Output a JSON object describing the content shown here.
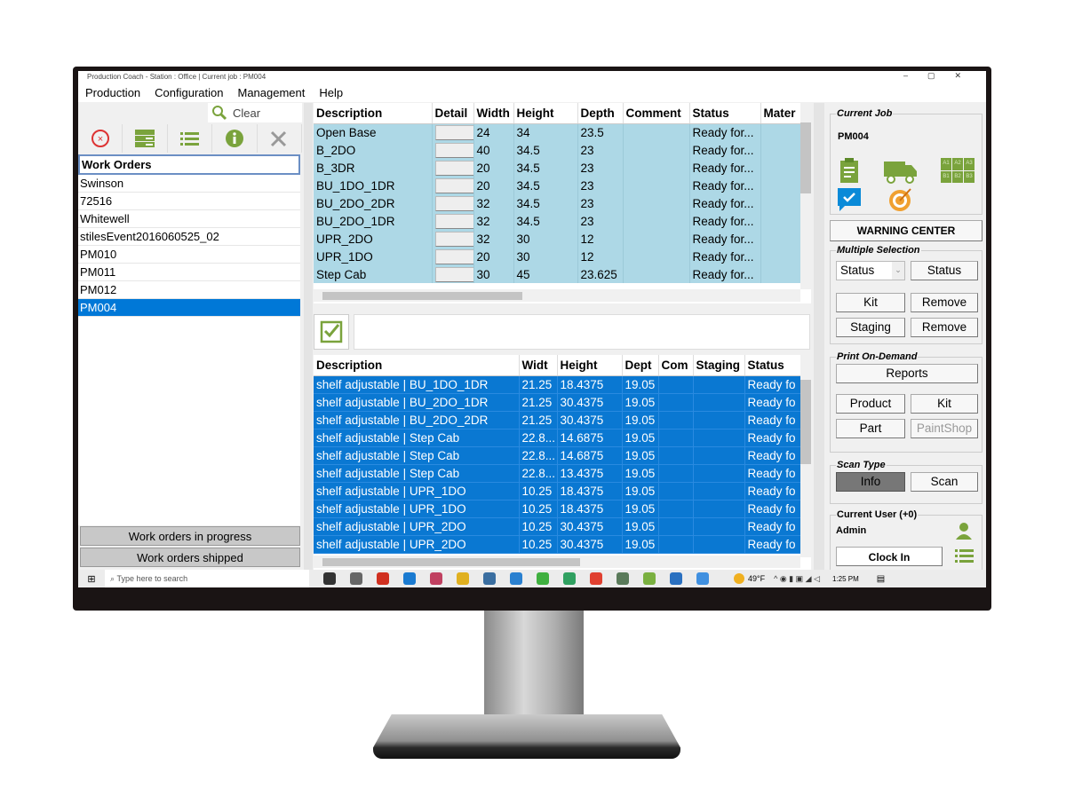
{
  "window": {
    "title": "Production Coach - Station : Office | Current job : PM004"
  },
  "menu": [
    "Production",
    "Configuration",
    "Management",
    "Help"
  ],
  "left": {
    "clear_label": "Clear",
    "list_header": "Work Orders",
    "items": [
      "Swinson",
      "72516",
      "Whitewell",
      "stilesEvent2016060525_02",
      "PM010",
      "PM011",
      "PM012",
      "PM004"
    ],
    "selected": "PM004",
    "btn_in_progress": "Work orders in progress",
    "btn_shipped": "Work orders shipped"
  },
  "top_table": {
    "columns": [
      "Description",
      "Detail",
      "Width",
      "Height",
      "Depth",
      "Comment",
      "Status",
      "Mater"
    ],
    "rows": [
      [
        "Open Base",
        "",
        "24",
        "34",
        "23.5",
        "",
        "Ready for...",
        ""
      ],
      [
        "B_2DO",
        "",
        "40",
        "34.5",
        "23",
        "",
        "Ready for...",
        ""
      ],
      [
        "B_3DR",
        "",
        "20",
        "34.5",
        "23",
        "",
        "Ready for...",
        ""
      ],
      [
        "BU_1DO_1DR",
        "",
        "20",
        "34.5",
        "23",
        "",
        "Ready for...",
        ""
      ],
      [
        "BU_2DO_2DR",
        "",
        "32",
        "34.5",
        "23",
        "",
        "Ready for...",
        ""
      ],
      [
        "BU_2DO_1DR",
        "",
        "32",
        "34.5",
        "23",
        "",
        "Ready for...",
        ""
      ],
      [
        "UPR_2DO",
        "",
        "32",
        "30",
        "12",
        "",
        "Ready for...",
        ""
      ],
      [
        "UPR_1DO",
        "",
        "20",
        "30",
        "12",
        "",
        "Ready for...",
        ""
      ],
      [
        "Step Cab",
        "",
        "30",
        "45",
        "23.625",
        "",
        "Ready for...",
        ""
      ]
    ]
  },
  "bottom_table": {
    "columns": [
      "Description",
      "Widt",
      "Height",
      "Dept",
      "Com",
      "Staging",
      "Status"
    ],
    "rows": [
      [
        "shelf adjustable | BU_1DO_1DR",
        "21.25",
        "18.4375",
        "19.05",
        "",
        "",
        "Ready fo"
      ],
      [
        "shelf adjustable | BU_2DO_1DR",
        "21.25",
        "30.4375",
        "19.05",
        "",
        "",
        "Ready fo"
      ],
      [
        "shelf adjustable | BU_2DO_2DR",
        "21.25",
        "30.4375",
        "19.05",
        "",
        "",
        "Ready fo"
      ],
      [
        "shelf adjustable | Step Cab",
        "22.8...",
        "14.6875",
        "19.05",
        "",
        "",
        "Ready fo"
      ],
      [
        "shelf adjustable | Step Cab",
        "22.8...",
        "14.6875",
        "19.05",
        "",
        "",
        "Ready fo"
      ],
      [
        "shelf adjustable | Step Cab",
        "22.8...",
        "13.4375",
        "19.05",
        "",
        "",
        "Ready fo"
      ],
      [
        "shelf adjustable | UPR_1DO",
        "10.25",
        "18.4375",
        "19.05",
        "",
        "",
        "Ready fo"
      ],
      [
        "shelf adjustable | UPR_1DO",
        "10.25",
        "18.4375",
        "19.05",
        "",
        "",
        "Ready fo"
      ],
      [
        "shelf adjustable | UPR_2DO",
        "10.25",
        "30.4375",
        "19.05",
        "",
        "",
        "Ready fo"
      ],
      [
        "shelf adjustable | UPR_2DO",
        "10.25",
        "30.4375",
        "19.05",
        "",
        "",
        "Ready fo"
      ]
    ]
  },
  "right": {
    "current_job": {
      "legend": "Current Job",
      "value": "PM004",
      "grid_labels": [
        "A1",
        "A2",
        "A3",
        "B1",
        "B2",
        "B3"
      ]
    },
    "warning_center": "WARNING CENTER",
    "multiple_selection": {
      "legend": "Multiple Selection",
      "select_value": "Status",
      "status_btn": "Status",
      "kit": "Kit",
      "remove1": "Remove",
      "staging": "Staging",
      "remove2": "Remove"
    },
    "print": {
      "legend": "Print On-Demand",
      "reports": "Reports",
      "product": "Product",
      "kit": "Kit",
      "part": "Part",
      "paintshop": "PaintShop"
    },
    "scan": {
      "legend": "Scan Type",
      "info": "Info",
      "scan": "Scan",
      "active": "Info"
    },
    "user": {
      "legend": "Current User (+0)",
      "name": "Admin",
      "clock_in": "Clock In"
    }
  },
  "taskbar": {
    "search_placeholder": "Type here to search",
    "weather": "49°F",
    "time": "1:25 PM"
  },
  "colors": {
    "accent": "#0078d7",
    "row_light": "#add8e6",
    "icon_green": "#7aa33c",
    "icon_orange": "#f0a030"
  }
}
